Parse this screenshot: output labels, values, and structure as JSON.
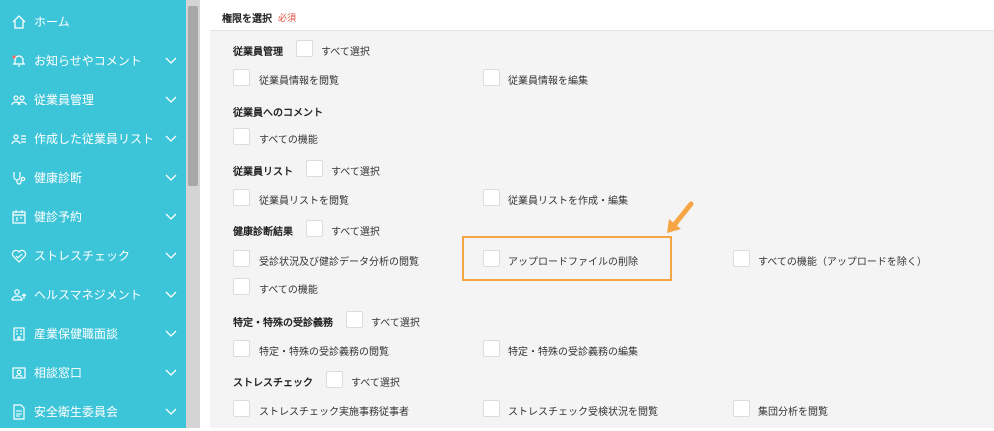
{
  "sidebar": {
    "items": [
      {
        "label": "ホーム",
        "icon": "home-icon",
        "has_chevron": false
      },
      {
        "label": "お知らせやコメント",
        "icon": "bell-icon",
        "has_chevron": true
      },
      {
        "label": "従業員管理",
        "icon": "people-icon",
        "has_chevron": true
      },
      {
        "label": "作成した従業員リスト",
        "icon": "user-list-icon",
        "has_chevron": true
      },
      {
        "label": "健康診断",
        "icon": "stethoscope-icon",
        "has_chevron": true
      },
      {
        "label": "健診予約",
        "icon": "calendar-icon",
        "has_chevron": true
      },
      {
        "label": "ストレスチェック",
        "icon": "heart-icon",
        "has_chevron": true
      },
      {
        "label": "ヘルスマネジメント",
        "icon": "person-upload-icon",
        "has_chevron": true
      },
      {
        "label": "産業保健職面談",
        "icon": "building-icon",
        "has_chevron": true
      },
      {
        "label": "相談窓口",
        "icon": "contact-card-icon",
        "has_chevron": true
      },
      {
        "label": "安全衛生委員会",
        "icon": "document-icon",
        "has_chevron": true
      }
    ]
  },
  "form": {
    "title": "権限を選択",
    "required_label": "必須"
  },
  "sections": [
    {
      "title": "従業員管理",
      "select_all_label": "すべて選択",
      "options": [
        {
          "label": "従業員情報を閲覧"
        },
        {
          "label": "従業員情報を編集"
        }
      ]
    },
    {
      "title": "従業員へのコメント",
      "select_all_label": "",
      "options": [
        {
          "label": "すべての機能"
        }
      ]
    },
    {
      "title": "従業員リスト",
      "select_all_label": "すべて選択",
      "options": [
        {
          "label": "従業員リストを閲覧"
        },
        {
          "label": "従業員リストを作成・編集"
        }
      ]
    },
    {
      "title": "健康診断結果",
      "select_all_label": "すべて選択",
      "options": [
        {
          "label": "受診状況及び健診データ分析の閲覧"
        },
        {
          "label": "アップロードファイルの削除"
        },
        {
          "label": "すべての機能（アップロードを除く）"
        },
        {
          "label": "すべての機能"
        }
      ]
    },
    {
      "title": "特定・特殊の受診義務",
      "select_all_label": "すべて選択",
      "options": [
        {
          "label": "特定・特殊の受診義務の閲覧"
        },
        {
          "label": "特定・特殊の受診義務の編集"
        }
      ]
    },
    {
      "title": "ストレスチェック",
      "select_all_label": "すべて選択",
      "options": [
        {
          "label": "ストレスチェック実施事務従事者"
        },
        {
          "label": "ストレスチェック受検状況を閲覧"
        },
        {
          "label": "集団分析を閲覧"
        }
      ]
    }
  ],
  "colors": {
    "sidebar_bg": "#3cc4d8",
    "highlight": "#f5a544",
    "required": "#e04a3a"
  }
}
